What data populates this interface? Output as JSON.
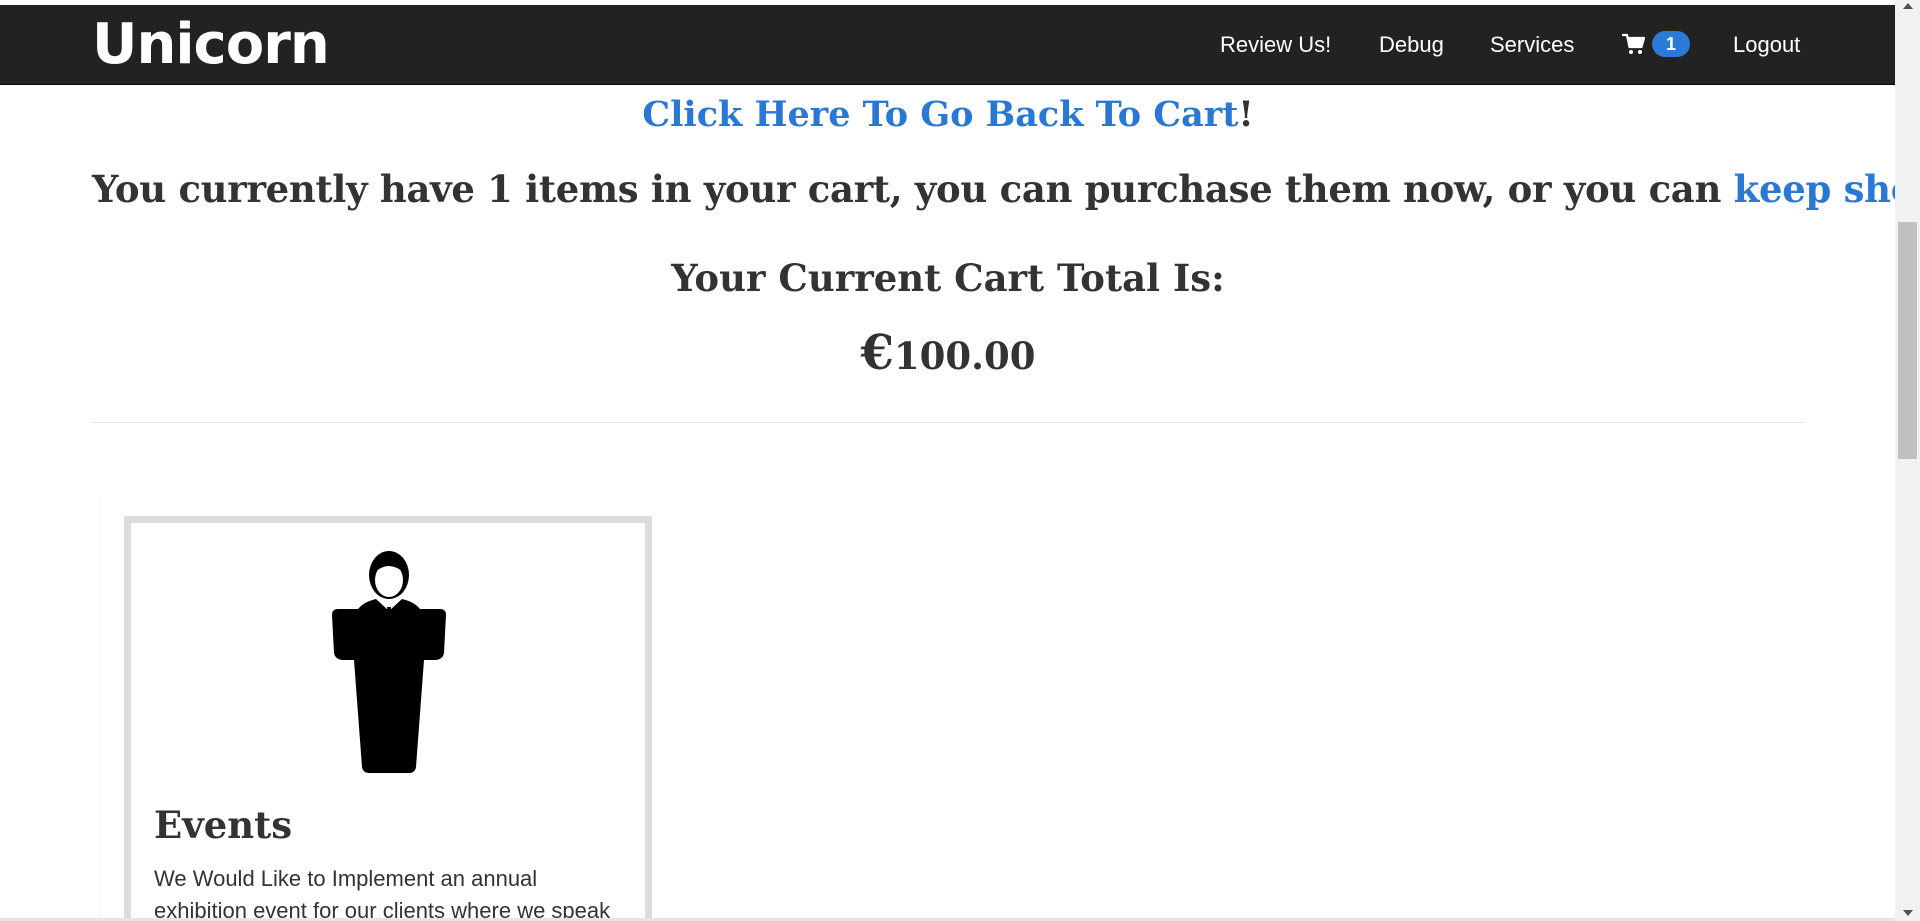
{
  "navbar": {
    "brand": "Unicorn",
    "links": {
      "review": "Review Us!",
      "debug": "Debug",
      "services": "Services",
      "logout": "Logout"
    },
    "cart_count": "1",
    "cart_icon": "shopping-cart-icon"
  },
  "main": {
    "back_link": "Click Here To Go Back To Cart",
    "back_suffix": "!",
    "cart_message_prefix": "You currently have 1 items in your cart, you can purchase them now, or you can ",
    "keep_shopping_link": "keep shopping",
    "cart_message_suffix": ".",
    "total_label": "Your Current Cart Total Is:",
    "total_currency": "€",
    "total_amount": "100.00"
  },
  "product": {
    "icon": "speaker-podium-icon",
    "title": "Events",
    "description": "We Would Like to Implement an annual exhibition event for our clients where we speak"
  },
  "colors": {
    "navbar_bg": "#222222",
    "link": "#2a78d5",
    "badge": "#2b7ad6",
    "text": "#333333"
  }
}
